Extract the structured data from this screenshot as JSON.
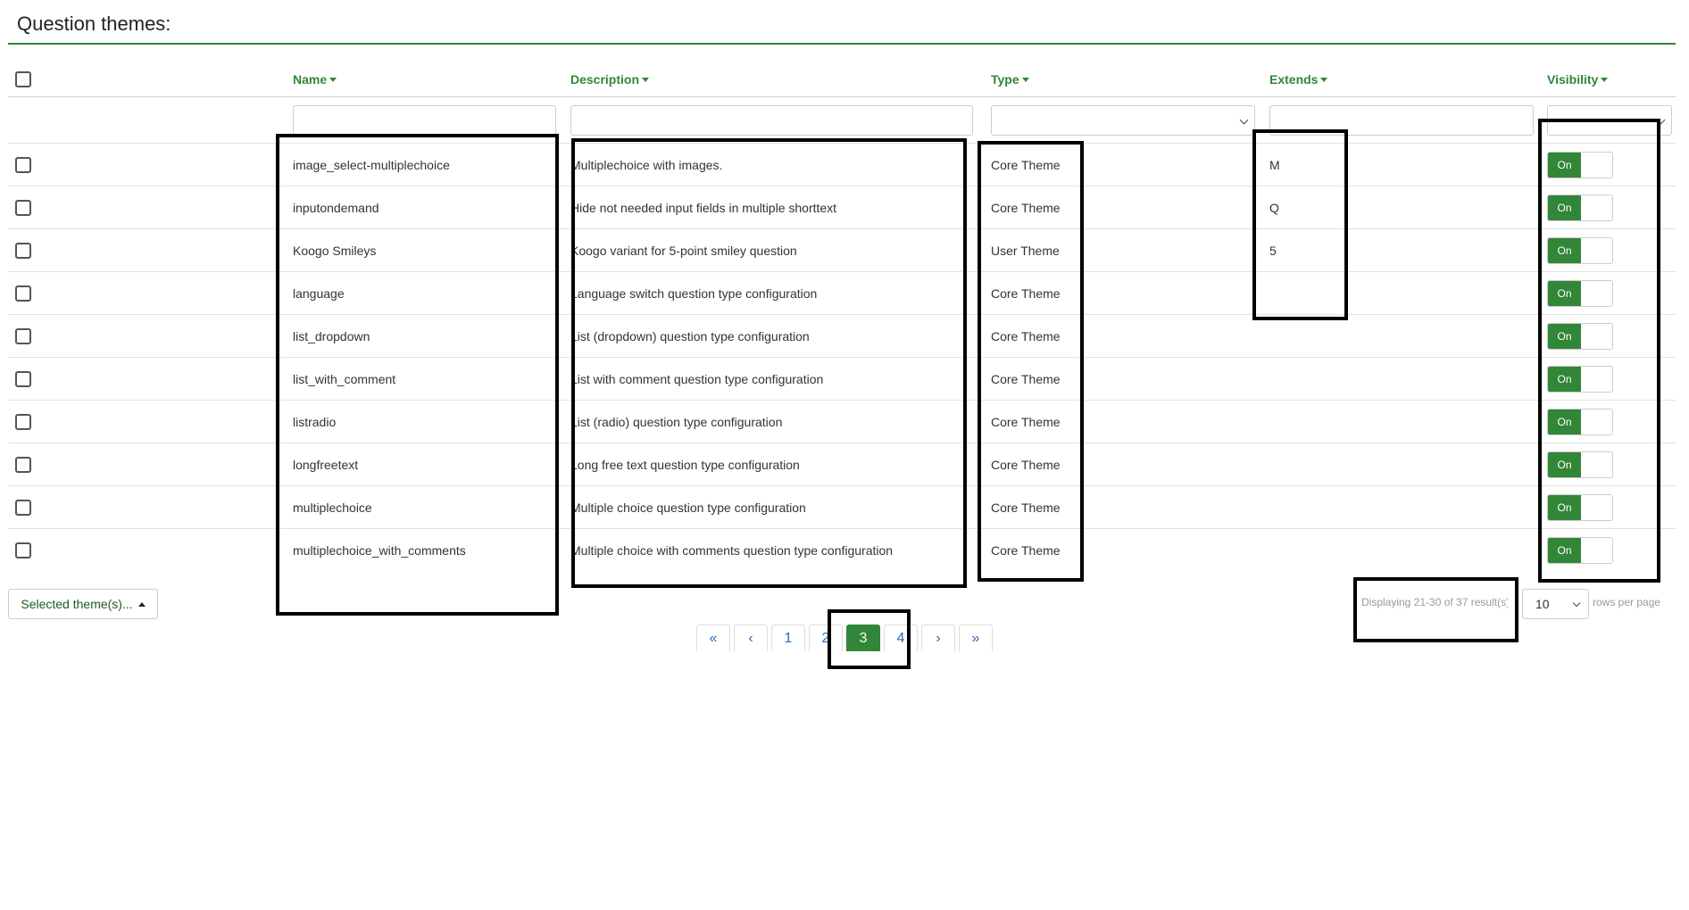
{
  "page": {
    "title": "Question themes:"
  },
  "columns": {
    "name": "Name",
    "description": "Description",
    "type": "Type",
    "extends": "Extends",
    "visibility": "Visibility"
  },
  "rows": [
    {
      "name": "image_select-multiplechoice",
      "description": "Multiplechoice with images.",
      "type": "Core Theme",
      "extends": "M",
      "visibility": "On"
    },
    {
      "name": "inputondemand",
      "description": "Hide not needed input fields in multiple shorttext",
      "type": "Core Theme",
      "extends": "Q",
      "visibility": "On"
    },
    {
      "name": "Koogo Smileys",
      "description": "Koogo variant for 5-point smiley question",
      "type": "User Theme",
      "extends": "5",
      "visibility": "On"
    },
    {
      "name": "language",
      "description": "Language switch question type configuration",
      "type": "Core Theme",
      "extends": "",
      "visibility": "On"
    },
    {
      "name": "list_dropdown",
      "description": "List (dropdown) question type configuration",
      "type": "Core Theme",
      "extends": "",
      "visibility": "On"
    },
    {
      "name": "list_with_comment",
      "description": "List with comment question type configuration",
      "type": "Core Theme",
      "extends": "",
      "visibility": "On"
    },
    {
      "name": "listradio",
      "description": "List (radio) question type configuration",
      "type": "Core Theme",
      "extends": "",
      "visibility": "On"
    },
    {
      "name": "longfreetext",
      "description": "Long free text question type configuration",
      "type": "Core Theme",
      "extends": "",
      "visibility": "On"
    },
    {
      "name": "multiplechoice",
      "description": "Multiple choice question type configuration",
      "type": "Core Theme",
      "extends": "",
      "visibility": "On"
    },
    {
      "name": "multiplechoice_with_comments",
      "description": "Multiple choice with comments question type configuration",
      "type": "Core Theme",
      "extends": "",
      "visibility": "On"
    }
  ],
  "footer": {
    "selected_button": "Selected theme(s)...",
    "summary": "Displaying 21-30 of 37 result(s).",
    "rows_per_page_value": "10",
    "rows_per_page_label": "rows per page"
  },
  "pagination": {
    "first": "«",
    "prev": "‹",
    "pages": [
      "1",
      "2",
      "3",
      "4"
    ],
    "current": "3",
    "next": "›",
    "last": "»"
  },
  "colors": {
    "accent": "#328637",
    "link": "#2a6bb2",
    "annotation": "#000000"
  }
}
